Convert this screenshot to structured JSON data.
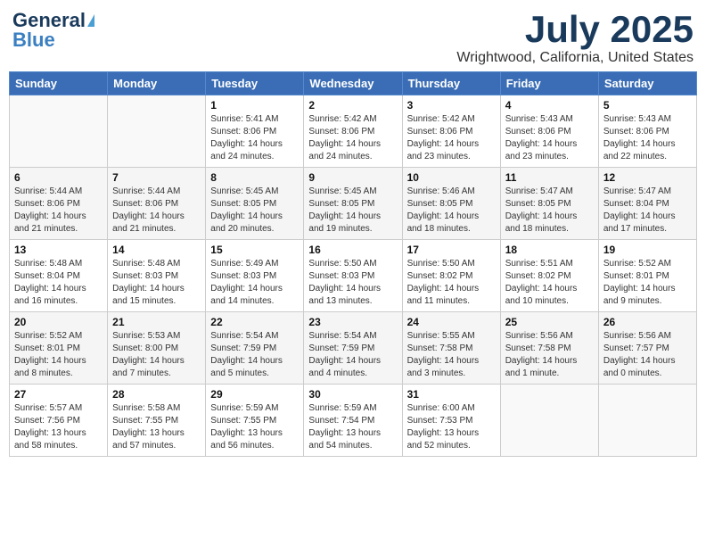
{
  "header": {
    "logo_line1": "General",
    "logo_line2": "Blue",
    "month": "July 2025",
    "location": "Wrightwood, California, United States"
  },
  "weekdays": [
    "Sunday",
    "Monday",
    "Tuesday",
    "Wednesday",
    "Thursday",
    "Friday",
    "Saturday"
  ],
  "weeks": [
    [
      {
        "day": "",
        "info": ""
      },
      {
        "day": "",
        "info": ""
      },
      {
        "day": "1",
        "info": "Sunrise: 5:41 AM\nSunset: 8:06 PM\nDaylight: 14 hours and 24 minutes."
      },
      {
        "day": "2",
        "info": "Sunrise: 5:42 AM\nSunset: 8:06 PM\nDaylight: 14 hours and 24 minutes."
      },
      {
        "day": "3",
        "info": "Sunrise: 5:42 AM\nSunset: 8:06 PM\nDaylight: 14 hours and 23 minutes."
      },
      {
        "day": "4",
        "info": "Sunrise: 5:43 AM\nSunset: 8:06 PM\nDaylight: 14 hours and 23 minutes."
      },
      {
        "day": "5",
        "info": "Sunrise: 5:43 AM\nSunset: 8:06 PM\nDaylight: 14 hours and 22 minutes."
      }
    ],
    [
      {
        "day": "6",
        "info": "Sunrise: 5:44 AM\nSunset: 8:06 PM\nDaylight: 14 hours and 21 minutes."
      },
      {
        "day": "7",
        "info": "Sunrise: 5:44 AM\nSunset: 8:06 PM\nDaylight: 14 hours and 21 minutes."
      },
      {
        "day": "8",
        "info": "Sunrise: 5:45 AM\nSunset: 8:05 PM\nDaylight: 14 hours and 20 minutes."
      },
      {
        "day": "9",
        "info": "Sunrise: 5:45 AM\nSunset: 8:05 PM\nDaylight: 14 hours and 19 minutes."
      },
      {
        "day": "10",
        "info": "Sunrise: 5:46 AM\nSunset: 8:05 PM\nDaylight: 14 hours and 18 minutes."
      },
      {
        "day": "11",
        "info": "Sunrise: 5:47 AM\nSunset: 8:05 PM\nDaylight: 14 hours and 18 minutes."
      },
      {
        "day": "12",
        "info": "Sunrise: 5:47 AM\nSunset: 8:04 PM\nDaylight: 14 hours and 17 minutes."
      }
    ],
    [
      {
        "day": "13",
        "info": "Sunrise: 5:48 AM\nSunset: 8:04 PM\nDaylight: 14 hours and 16 minutes."
      },
      {
        "day": "14",
        "info": "Sunrise: 5:48 AM\nSunset: 8:03 PM\nDaylight: 14 hours and 15 minutes."
      },
      {
        "day": "15",
        "info": "Sunrise: 5:49 AM\nSunset: 8:03 PM\nDaylight: 14 hours and 14 minutes."
      },
      {
        "day": "16",
        "info": "Sunrise: 5:50 AM\nSunset: 8:03 PM\nDaylight: 14 hours and 13 minutes."
      },
      {
        "day": "17",
        "info": "Sunrise: 5:50 AM\nSunset: 8:02 PM\nDaylight: 14 hours and 11 minutes."
      },
      {
        "day": "18",
        "info": "Sunrise: 5:51 AM\nSunset: 8:02 PM\nDaylight: 14 hours and 10 minutes."
      },
      {
        "day": "19",
        "info": "Sunrise: 5:52 AM\nSunset: 8:01 PM\nDaylight: 14 hours and 9 minutes."
      }
    ],
    [
      {
        "day": "20",
        "info": "Sunrise: 5:52 AM\nSunset: 8:01 PM\nDaylight: 14 hours and 8 minutes."
      },
      {
        "day": "21",
        "info": "Sunrise: 5:53 AM\nSunset: 8:00 PM\nDaylight: 14 hours and 7 minutes."
      },
      {
        "day": "22",
        "info": "Sunrise: 5:54 AM\nSunset: 7:59 PM\nDaylight: 14 hours and 5 minutes."
      },
      {
        "day": "23",
        "info": "Sunrise: 5:54 AM\nSunset: 7:59 PM\nDaylight: 14 hours and 4 minutes."
      },
      {
        "day": "24",
        "info": "Sunrise: 5:55 AM\nSunset: 7:58 PM\nDaylight: 14 hours and 3 minutes."
      },
      {
        "day": "25",
        "info": "Sunrise: 5:56 AM\nSunset: 7:58 PM\nDaylight: 14 hours and 1 minute."
      },
      {
        "day": "26",
        "info": "Sunrise: 5:56 AM\nSunset: 7:57 PM\nDaylight: 14 hours and 0 minutes."
      }
    ],
    [
      {
        "day": "27",
        "info": "Sunrise: 5:57 AM\nSunset: 7:56 PM\nDaylight: 13 hours and 58 minutes."
      },
      {
        "day": "28",
        "info": "Sunrise: 5:58 AM\nSunset: 7:55 PM\nDaylight: 13 hours and 57 minutes."
      },
      {
        "day": "29",
        "info": "Sunrise: 5:59 AM\nSunset: 7:55 PM\nDaylight: 13 hours and 56 minutes."
      },
      {
        "day": "30",
        "info": "Sunrise: 5:59 AM\nSunset: 7:54 PM\nDaylight: 13 hours and 54 minutes."
      },
      {
        "day": "31",
        "info": "Sunrise: 6:00 AM\nSunset: 7:53 PM\nDaylight: 13 hours and 52 minutes."
      },
      {
        "day": "",
        "info": ""
      },
      {
        "day": "",
        "info": ""
      }
    ]
  ]
}
